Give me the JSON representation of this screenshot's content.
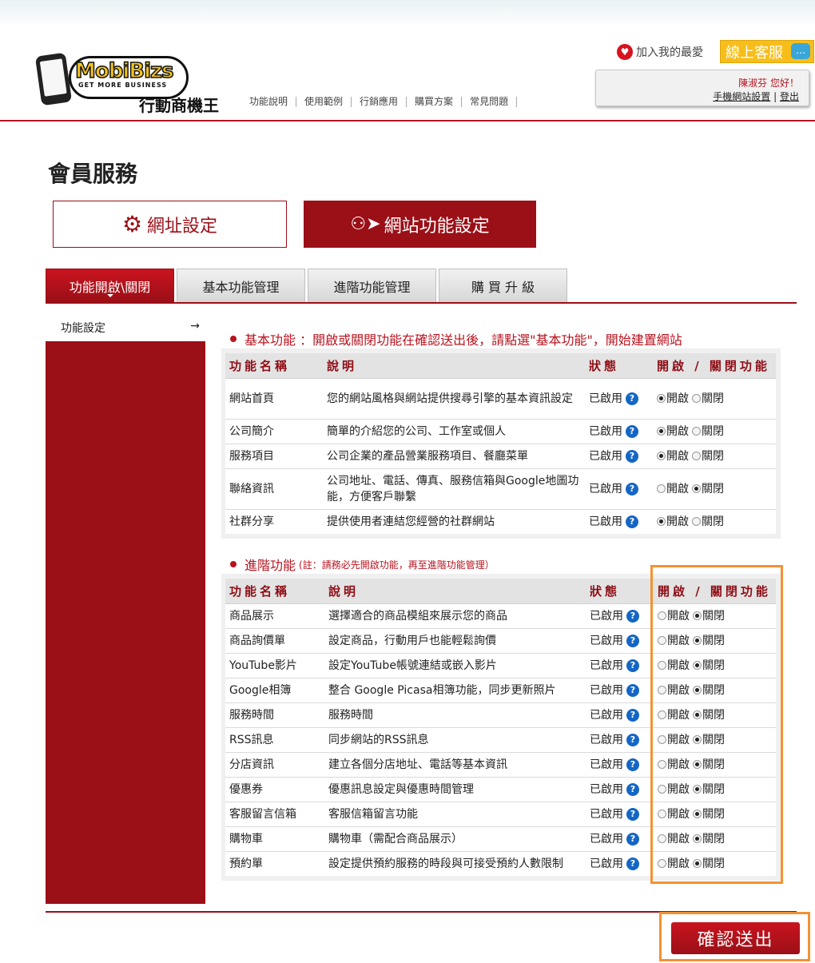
{
  "logo": {
    "word": "MobiBizs",
    "tagline": "GET MORE BUSINESS",
    "cn": "行動商機王"
  },
  "topnav": [
    "功能說明",
    "使用範例",
    "行銷應用",
    "購買方案",
    "常見問題"
  ],
  "header": {
    "favorite": "加入我的最愛",
    "chat": "線上客服",
    "greeting": "陳淑芬 您好！",
    "site_settings": "手機網站設置",
    "separator": "|",
    "logout": "登出"
  },
  "page_title": "會員服務",
  "big_buttons": {
    "url_settings": "網址設定",
    "site_functions": "網站功能設定"
  },
  "tabs": [
    "功能開啟\\關閉",
    "基本功能管理",
    "進階功能管理",
    "購 買 升 級"
  ],
  "sidebar": {
    "item": "功能設定",
    "arrow": "→"
  },
  "basic": {
    "title": "基本功能 ：開啟或關閉功能在確認送出後，請點選\"基本功能\"，開始建置網站",
    "headers": [
      "功能名稱",
      "說明",
      "狀態",
      "開啟 / 關閉功能"
    ],
    "rows": [
      {
        "name": "網站首頁",
        "desc": "您的網站風格與網站提供搜尋引擎的基本資訊設定",
        "status": "已啟用",
        "open": true
      },
      {
        "name": "公司簡介",
        "desc": "簡單的介紹您的公司、工作室或個人",
        "status": "已啟用",
        "open": true
      },
      {
        "name": "服務項目",
        "desc": "公司企業的產品營業服務項目、餐廳菜單",
        "status": "已啟用",
        "open": true
      },
      {
        "name": "聯絡資訊",
        "desc": "公司地址、電話、傳真、服務信箱與Google地圖功能，方便客戶聯繫",
        "status": "已啟用",
        "open": false
      },
      {
        "name": "社群分享",
        "desc": "提供使用者連結您經營的社群網站",
        "status": "已啟用",
        "open": true
      }
    ]
  },
  "advanced": {
    "title": "進階功能",
    "note": "(註：請務必先開啟功能，再至進階功能管理）",
    "headers": [
      "功能名稱",
      "說明",
      "狀態",
      "開啟 / 關閉功能"
    ],
    "rows": [
      {
        "name": "商品展示",
        "desc": "選擇適合的商品模組來展示您的商品",
        "status": "已啟用",
        "open": false
      },
      {
        "name": "商品詢價單",
        "desc": "設定商品，行動用戶也能輕鬆詢價",
        "status": "已啟用",
        "open": false
      },
      {
        "name": "YouTube影片",
        "desc": "設定YouTube帳號連結或嵌入影片",
        "status": "已啟用",
        "open": false
      },
      {
        "name": "Google相簿",
        "desc": "整合 Google Picasa相簿功能，同步更新照片",
        "status": "已啟用",
        "open": false
      },
      {
        "name": "服務時間",
        "desc": "服務時間",
        "status": "已啟用",
        "open": false
      },
      {
        "name": "RSS訊息",
        "desc": "同步網站的RSS訊息",
        "status": "已啟用",
        "open": false
      },
      {
        "name": "分店資訊",
        "desc": "建立各個分店地址、電話等基本資訊",
        "status": "已啟用",
        "open": false
      },
      {
        "name": "優惠券",
        "desc": "優惠訊息設定與優惠時間管理",
        "status": "已啟用",
        "open": false
      },
      {
        "name": "客服留言信箱",
        "desc": "客服信箱留言功能",
        "status": "已啟用",
        "open": false
      },
      {
        "name": "購物車",
        "desc": "購物車（需配合商品展示）",
        "status": "已啟用",
        "open": false
      },
      {
        "name": "預約單",
        "desc": "設定提供預約服務的時段與可接受預約人數限制",
        "status": "已啟用",
        "open": false
      }
    ]
  },
  "radio_labels": {
    "on": "開啟",
    "off": "關閉"
  },
  "help_glyph": "?",
  "submit": "確認送出",
  "colors": {
    "brand": "#9b0f17",
    "highlight": "#f39233",
    "help": "#1466c6",
    "chat": "#f7be1b"
  }
}
